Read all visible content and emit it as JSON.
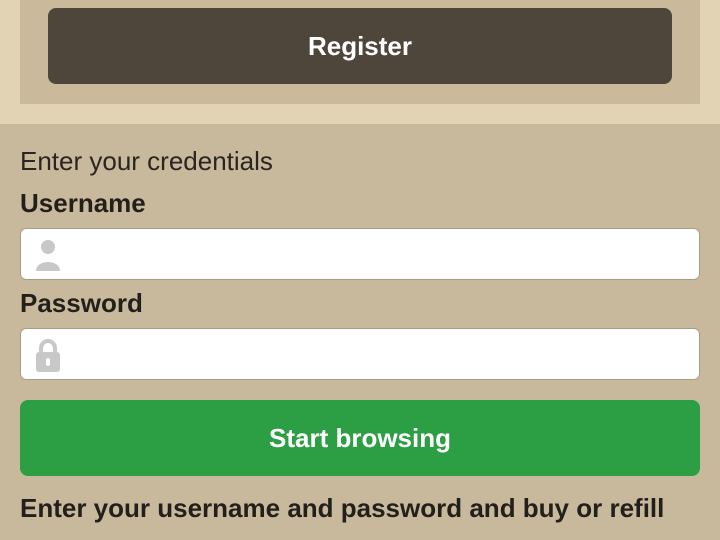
{
  "register": {
    "label": "Register"
  },
  "login": {
    "title": "Enter your credentials",
    "username_label": "Username",
    "username_value": "",
    "password_label": "Password",
    "password_value": "",
    "username_icon": "user-icon",
    "password_icon": "lock-icon",
    "submit_label": "Start browsing"
  },
  "instructions": {
    "text": "Enter your username and password and buy or refill"
  },
  "colors": {
    "page_background": "#c9b99c",
    "top_band": "#e2d3b4",
    "register_button": "#4f463b",
    "start_button": "#2c9e43"
  }
}
